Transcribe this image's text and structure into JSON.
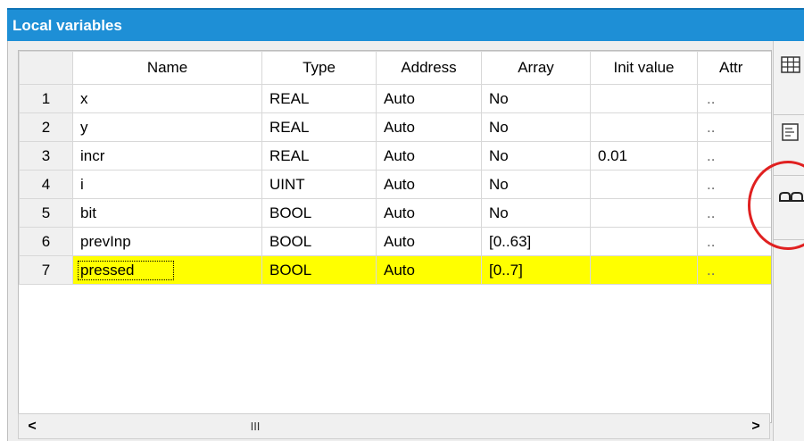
{
  "window": {
    "title": "Local variables"
  },
  "table": {
    "columns": [
      "",
      "Name",
      "Type",
      "Address",
      "Array",
      "Init value",
      "Attr"
    ],
    "rows": [
      {
        "num": "1",
        "name": "x",
        "type": "REAL",
        "address": "Auto",
        "array": "No",
        "init": "",
        "attr": ".."
      },
      {
        "num": "2",
        "name": "y",
        "type": "REAL",
        "address": "Auto",
        "array": "No",
        "init": "",
        "attr": ".."
      },
      {
        "num": "3",
        "name": "incr",
        "type": "REAL",
        "address": "Auto",
        "array": "No",
        "init": "0.01",
        "attr": ".."
      },
      {
        "num": "4",
        "name": "i",
        "type": "UINT",
        "address": "Auto",
        "array": "No",
        "init": "",
        "attr": ".."
      },
      {
        "num": "5",
        "name": "bit",
        "type": "BOOL",
        "address": "Auto",
        "array": "No",
        "init": "",
        "attr": ".."
      },
      {
        "num": "6",
        "name": "prevInp",
        "type": "BOOL",
        "address": "Auto",
        "array": "[0..63]",
        "init": "",
        "attr": ".."
      },
      {
        "num": "7",
        "name": "pressed",
        "type": "BOOL",
        "address": "Auto",
        "array": "[0..7]",
        "init": "",
        "attr": ".."
      }
    ],
    "selected_row_index": 6,
    "selected_color": "#ffff00"
  },
  "scrollbar": {
    "left_arrow": "<",
    "right_arrow": ">",
    "thumb_grip": "III"
  },
  "toolbar": {
    "icons": [
      "table-grid-icon",
      "properties-icon",
      "link-chain-icon"
    ]
  },
  "colors": {
    "titlebar": "#1e8fd6",
    "highlight_circle": "#e02020"
  }
}
